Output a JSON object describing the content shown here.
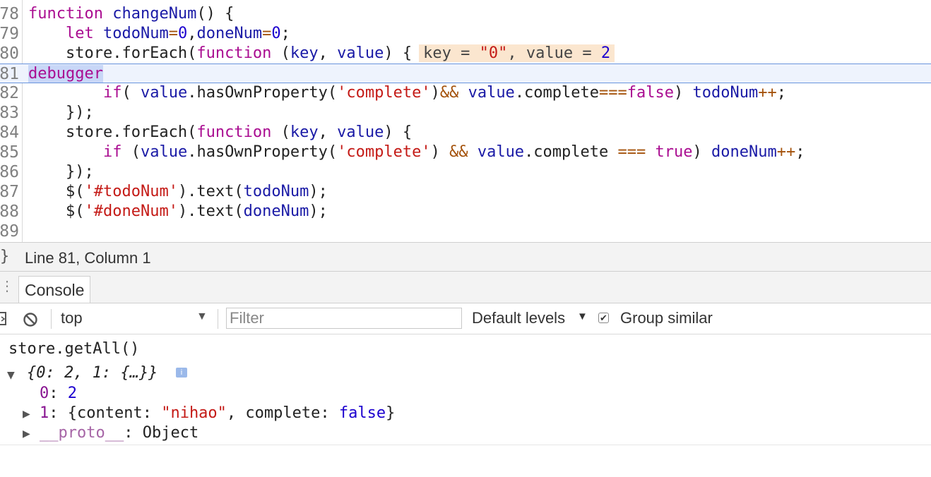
{
  "editor": {
    "lines": [
      {
        "num": "78",
        "tokens": [
          [
            "kw",
            "function"
          ],
          [
            "plain",
            " "
          ],
          [
            "id",
            "changeNum"
          ],
          [
            "plain",
            "() {"
          ]
        ]
      },
      {
        "num": "79",
        "tokens": [
          [
            "plain",
            "    "
          ],
          [
            "kw",
            "let"
          ],
          [
            "plain",
            " "
          ],
          [
            "id",
            "todoNum"
          ],
          [
            "op",
            "="
          ],
          [
            "num",
            "0"
          ],
          [
            "plain",
            ","
          ],
          [
            "id",
            "doneNum"
          ],
          [
            "op",
            "="
          ],
          [
            "num",
            "0"
          ],
          [
            "plain",
            ";"
          ]
        ]
      },
      {
        "num": "80",
        "tokens": [
          [
            "plain",
            "    store.forEach("
          ],
          [
            "kw",
            "function"
          ],
          [
            "plain",
            " ("
          ],
          [
            "id",
            "key"
          ],
          [
            "plain",
            ", "
          ],
          [
            "id",
            "value"
          ],
          [
            "plain",
            ") {"
          ]
        ]
      },
      {
        "num": "81",
        "tokens": []
      },
      {
        "num": "82",
        "tokens": [
          [
            "plain",
            "        "
          ],
          [
            "kw",
            "if"
          ],
          [
            "plain",
            "( "
          ],
          [
            "id",
            "value"
          ],
          [
            "plain",
            ".hasOwnProperty("
          ],
          [
            "str",
            "'complete'"
          ],
          [
            "plain",
            ")"
          ],
          [
            "op",
            "&&"
          ],
          [
            "plain",
            " "
          ],
          [
            "id",
            "value"
          ],
          [
            "plain",
            ".complete"
          ],
          [
            "op",
            "==="
          ],
          [
            "kw",
            "false"
          ],
          [
            "plain",
            ") "
          ],
          [
            "id",
            "todoNum"
          ],
          [
            "op",
            "++"
          ],
          [
            "plain",
            ";"
          ]
        ]
      },
      {
        "num": "83",
        "tokens": [
          [
            "plain",
            "    });"
          ]
        ]
      },
      {
        "num": "84",
        "tokens": [
          [
            "plain",
            "    store.forEach("
          ],
          [
            "kw",
            "function"
          ],
          [
            "plain",
            " ("
          ],
          [
            "id",
            "key"
          ],
          [
            "plain",
            ", "
          ],
          [
            "id",
            "value"
          ],
          [
            "plain",
            ") {"
          ]
        ]
      },
      {
        "num": "85",
        "tokens": [
          [
            "plain",
            "        "
          ],
          [
            "kw",
            "if"
          ],
          [
            "plain",
            " ("
          ],
          [
            "id",
            "value"
          ],
          [
            "plain",
            ".hasOwnProperty("
          ],
          [
            "str",
            "'complete'"
          ],
          [
            "plain",
            ") "
          ],
          [
            "op",
            "&&"
          ],
          [
            "plain",
            " "
          ],
          [
            "id",
            "value"
          ],
          [
            "plain",
            ".complete "
          ],
          [
            "op",
            "==="
          ],
          [
            "plain",
            " "
          ],
          [
            "kw",
            "true"
          ],
          [
            "plain",
            ") "
          ],
          [
            "id",
            "doneNum"
          ],
          [
            "op",
            "++"
          ],
          [
            "plain",
            ";"
          ]
        ]
      },
      {
        "num": "86",
        "tokens": [
          [
            "plain",
            "    });"
          ]
        ]
      },
      {
        "num": "87",
        "tokens": [
          [
            "plain",
            "    $("
          ],
          [
            "str",
            "'#todoNum'"
          ],
          [
            "plain",
            ").text("
          ],
          [
            "id",
            "todoNum"
          ],
          [
            "plain",
            ");"
          ]
        ]
      },
      {
        "num": "88",
        "tokens": [
          [
            "plain",
            "    $("
          ],
          [
            "str",
            "'#doneNum'"
          ],
          [
            "plain",
            ").text("
          ],
          [
            "id",
            "doneNum"
          ],
          [
            "plain",
            ");"
          ]
        ]
      },
      {
        "num": "89",
        "tokens": []
      }
    ],
    "debugger_keyword": "debugger",
    "inline_value": {
      "key_label": "key = ",
      "key_val": "\"0\"",
      "sep": ", value = ",
      "value_val": "2"
    }
  },
  "status": {
    "brace": "}",
    "cursor_position": "Line 81, Column 1"
  },
  "console_tab": {
    "label": "Console"
  },
  "toolbar": {
    "context": "top",
    "filter_placeholder": "Filter",
    "levels": "Default levels",
    "group_similar_label": "Group similar",
    "group_similar_checked": true
  },
  "output": {
    "command": "store.getAll()",
    "object_summary": "{0: 2, 1: {…}}",
    "info_badge": "i",
    "prop0": {
      "key": "0",
      "colon": ": ",
      "value": "2"
    },
    "prop1": {
      "key": "1",
      "colon": ": ",
      "open": "{content: ",
      "content": "\"nihao\"",
      "mid": ", complete: ",
      "complete": "false",
      "close": "}"
    },
    "prop2": {
      "key": "__proto__",
      "colon": ": ",
      "value": "Object"
    }
  }
}
